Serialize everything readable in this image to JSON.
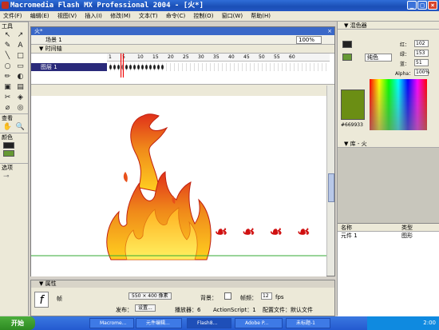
{
  "window": {
    "title": "Macromedia Flash MX Professional 2004 - [火*]",
    "buttons": [
      "_",
      "□",
      "×"
    ]
  },
  "menubar": {
    "items": [
      "文件(F)",
      "编辑(E)",
      "视图(V)",
      "插入(I)",
      "修改(M)",
      "文本(T)",
      "命令(C)",
      "控制(O)",
      "窗口(W)",
      "帮助(H)"
    ]
  },
  "toolbox": {
    "tools_head": "工具",
    "view_head": "查看",
    "color_head": "颜色",
    "options_head": "选项",
    "tool_glyphs": [
      "↖",
      "↗",
      "✎",
      "A",
      "╲",
      "□",
      "○",
      "▭",
      "✏",
      "◐",
      "▣",
      "▤",
      "✂",
      "◈",
      "⌀",
      "◎"
    ],
    "view_glyphs": [
      "✋",
      "🔍"
    ]
  },
  "document": {
    "tab": "火*",
    "close": "×",
    "scene": "场景 1",
    "zoom": "100%",
    "timeline_head": "▼ 时间轴",
    "layer": "图层 1",
    "ruler": [
      "1",
      "5",
      "10",
      "15",
      "20",
      "25",
      "30",
      "35",
      "40",
      "45",
      "50",
      "55",
      "60"
    ],
    "frames_filled": 14
  },
  "stage": {
    "text": "☙ ☙ ☙ ☙",
    "accent": "#d01010"
  },
  "properties": {
    "header": "▼ 属性",
    "type_label": "帧",
    "size_btn": "550 × 400 像素",
    "bg_label": "背景：",
    "fps_label": "帧频：",
    "fps": "12",
    "fps_unit": "fps",
    "publish_label": "发布：",
    "settings_btn": "设置...",
    "player_label": "播放器：6",
    "script_label": "ActionScript：1",
    "profile_label": "配置文件：默认文件"
  },
  "rightpanel": {
    "mixer_head": "▼ 混色器",
    "type_value": "纯色",
    "r_label": "红：",
    "r": "102",
    "g_label": "绿：",
    "g": "153",
    "b_label": "蓝：",
    "b": "51",
    "alpha_label": "Alpha：",
    "alpha": "100%",
    "hex": "#669933",
    "library_head": "▼ 库 - 火",
    "lib_col_name": "名称",
    "lib_col_type": "类型",
    "lib_item": "元件 1",
    "lib_item_type": "图形"
  },
  "taskbar": {
    "start": "开始",
    "tasks": [
      "Macrome...",
      "元件编辑...",
      "Flash8...",
      "Adobe P...",
      "未标题-1"
    ],
    "time": "2:00"
  },
  "colors": {
    "fill": "#669933",
    "title_blue": "#1a4fb6"
  }
}
